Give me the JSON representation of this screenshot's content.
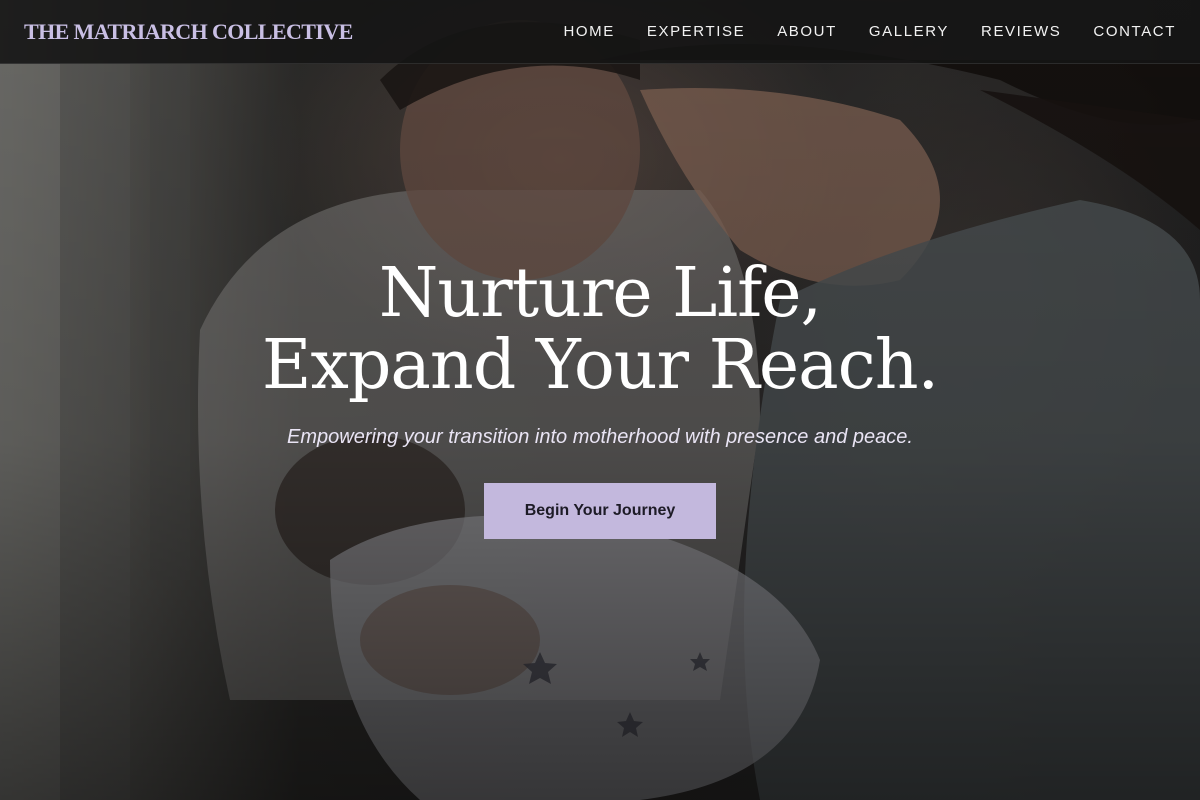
{
  "brand": {
    "name": "THE MATRIARCH COLLECTIVE"
  },
  "nav": {
    "items": [
      {
        "label": "HOME"
      },
      {
        "label": "EXPERTISE"
      },
      {
        "label": "ABOUT"
      },
      {
        "label": "GALLERY"
      },
      {
        "label": "REVIEWS"
      },
      {
        "label": "CONTACT"
      }
    ]
  },
  "hero": {
    "headline_line1": "Nurture Life,",
    "headline_line2": "Expand Your Reach.",
    "subtitle": "Empowering your transition into motherhood with presence and peace.",
    "cta_label": "Begin Your Journey",
    "image_subject": "parents holding newborn baby"
  },
  "colors": {
    "brand_text": "#c9bfe4",
    "cta_background": "#c3b8dd",
    "header_background": "#141414"
  }
}
